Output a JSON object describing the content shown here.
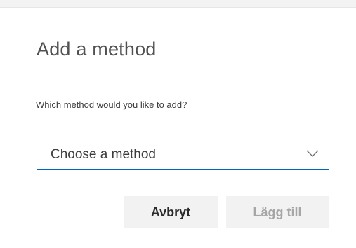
{
  "dialog": {
    "title": "Add a method",
    "question": "Which method would you like to add?",
    "method_select": {
      "selected_text": "Choose a method",
      "icon": "chevron-down-icon"
    },
    "buttons": {
      "cancel_label": "Avbryt",
      "add_label": "Lägg till"
    }
  },
  "colors": {
    "accent": "#0067b8",
    "button_bg": "#f2f2f2",
    "disabled_text": "#a6a6a6"
  }
}
